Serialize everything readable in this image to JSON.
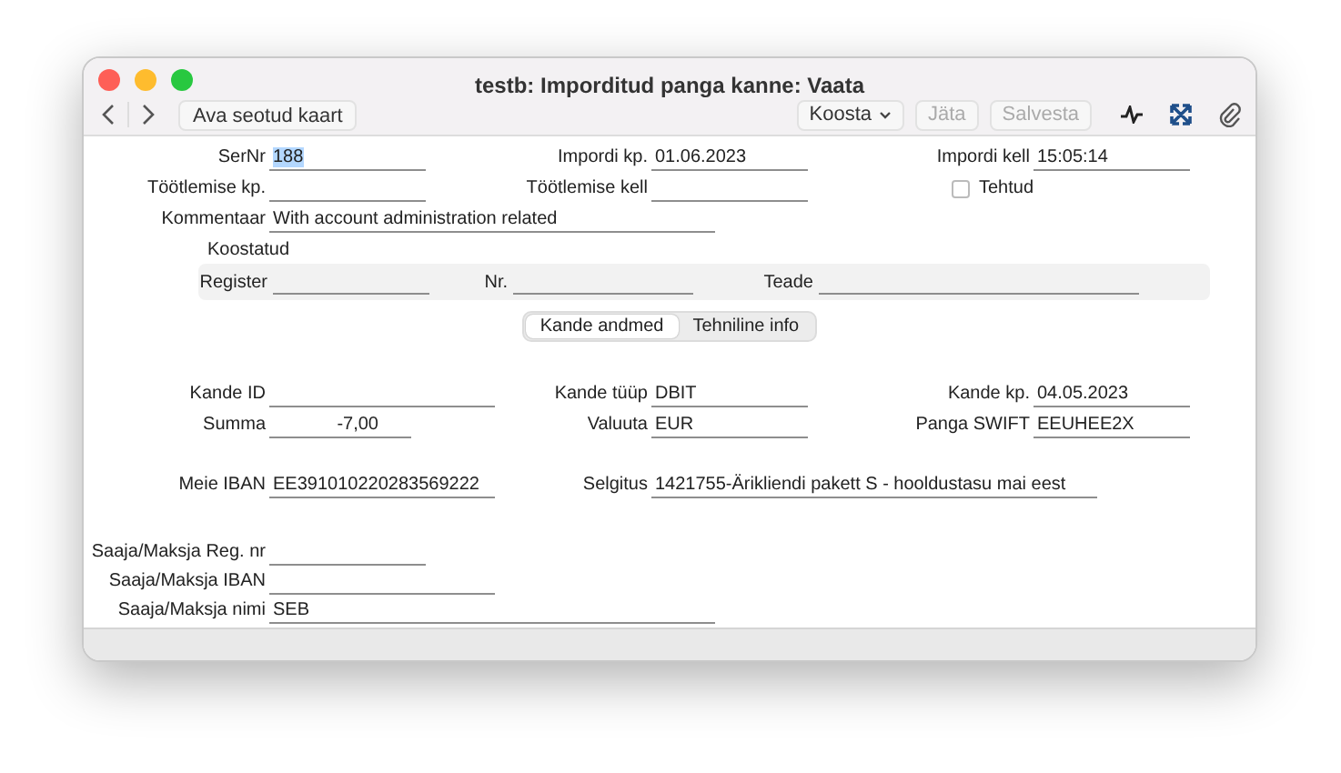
{
  "window": {
    "title": "testb: Imporditud panga kanne: Vaata"
  },
  "toolbar": {
    "buttons": [
      {
        "label": "Ava seotud kaart",
        "disabled": false
      }
    ],
    "right_buttons": [
      {
        "label": "Koosta",
        "kind": "menu",
        "disabled": false
      },
      {
        "label": "Jäta",
        "kind": "push",
        "disabled": true
      },
      {
        "label": "Salvesta",
        "kind": "push",
        "disabled": true
      }
    ]
  },
  "header_rows": [
    [
      {
        "label": "SerNr",
        "value": "188",
        "text_selected": true
      },
      {
        "label": "Impordi kp.",
        "value": "01.06.2023"
      },
      {
        "label": "Impordi kell",
        "value": "15:05:14"
      }
    ],
    [
      {
        "label": "Töötlemise kp."
      },
      {
        "label": "Töötlemise kell"
      },
      {
        "label": "Tehtud",
        "kind": "checkbox",
        "checked": false
      }
    ],
    [
      {
        "label": "Kommentaar",
        "value": "With account administration related"
      }
    ]
  ],
  "koostatud": {
    "title": "Koostatud",
    "fields": [
      {
        "label": "Register"
      },
      {
        "label": "Nr."
      },
      {
        "label": "Teade"
      }
    ]
  },
  "tabs": [
    {
      "label": "Kande andmed",
      "selected": true
    },
    {
      "label": "Tehniline info",
      "selected": false
    }
  ],
  "detail_rows": [
    [
      {
        "label": "Kande ID"
      },
      {
        "label": "Kande tüüp",
        "value": "DBIT"
      },
      {
        "label": "Kande kp.",
        "value": "04.05.2023"
      }
    ],
    [
      {
        "label": "Summa",
        "value": "-7,00"
      },
      {
        "label": "Valuuta",
        "value": "EUR"
      },
      {
        "label": "Panga SWIFT",
        "value": "EEUHEE2X"
      }
    ],
    [
      {
        "label": "Meie IBAN",
        "value": "EE391010220283569222"
      },
      {
        "label": "Selgitus",
        "value": "1421755-Ärikliendi pakett S - hooldustasu mai eest"
      }
    ]
  ],
  "party_rows": [
    {
      "label": "Saaja/Maksja Reg. nr"
    },
    {
      "label": "Saaja/Maksja IBAN"
    },
    {
      "label": "Saaja/Maksja nimi",
      "value": "SEB"
    }
  ]
}
